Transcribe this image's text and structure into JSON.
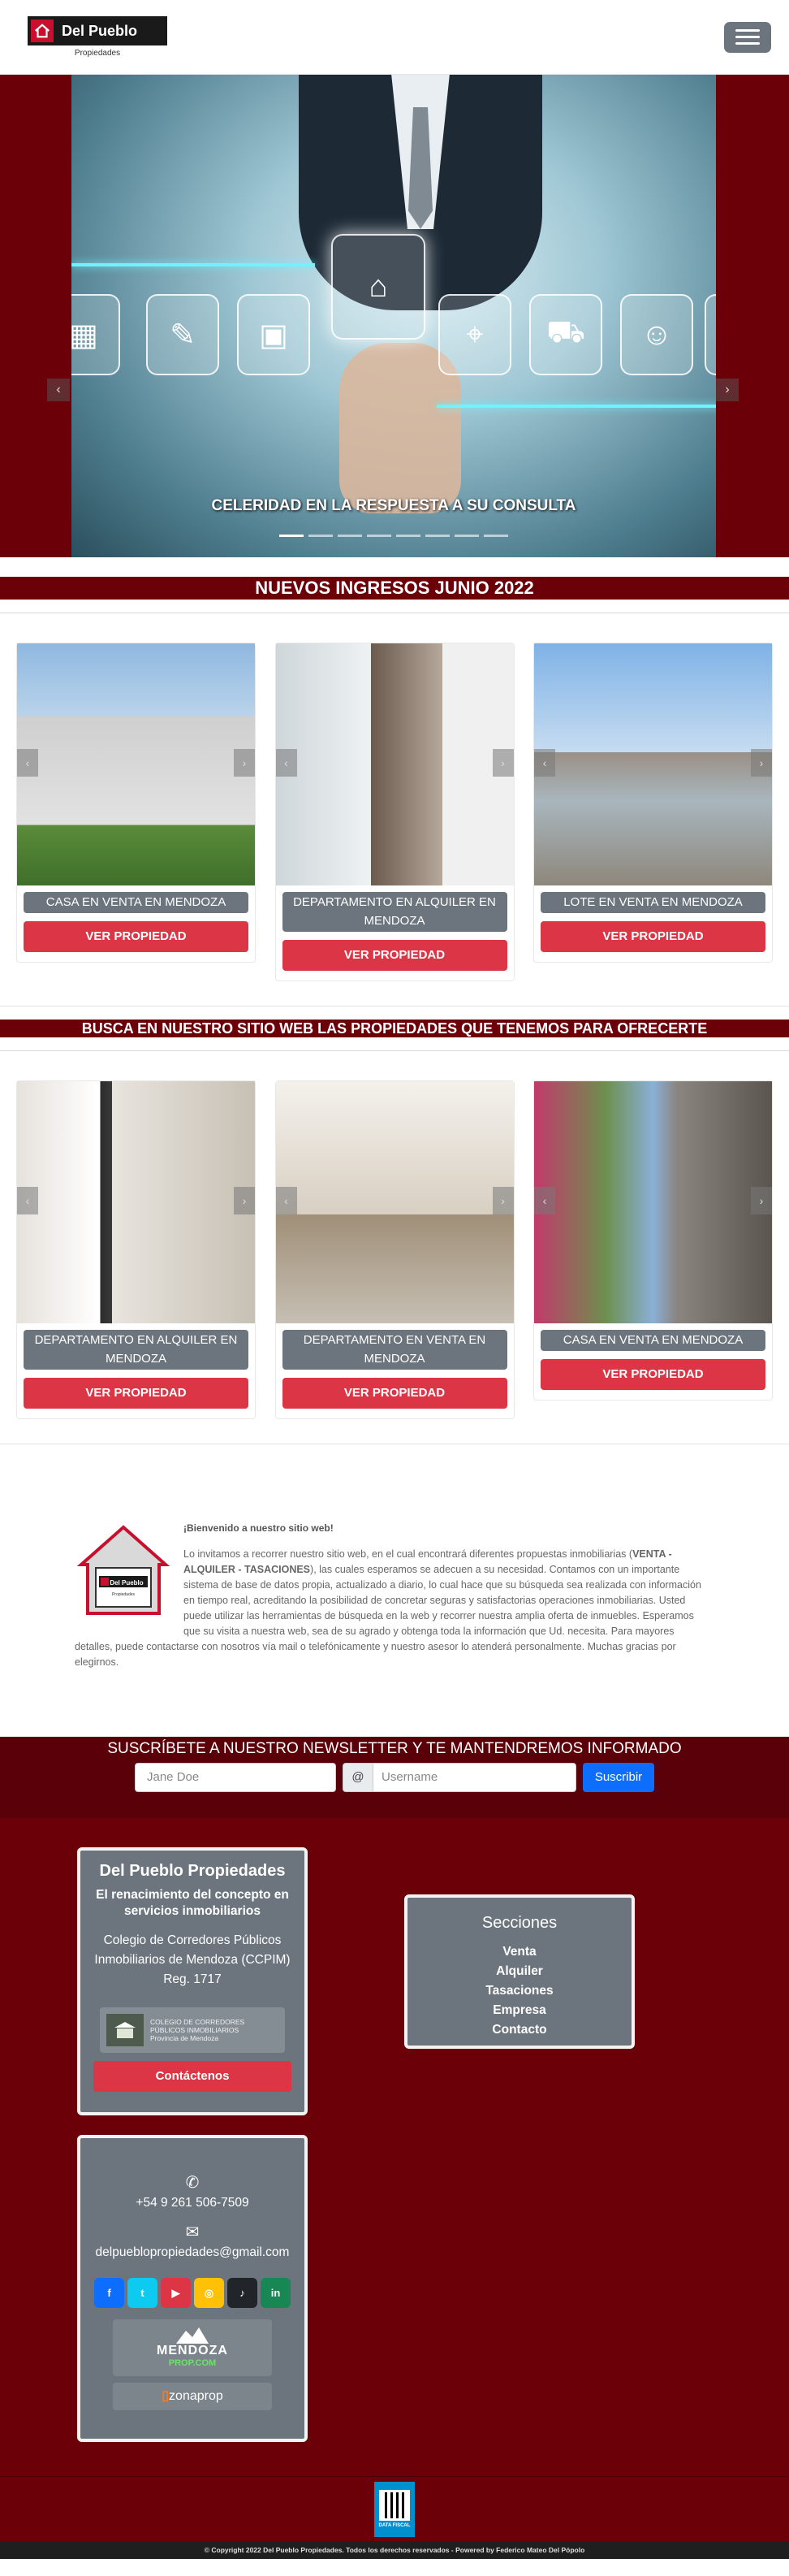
{
  "brand": {
    "name": "Del Pueblo",
    "tagline": "Propiedades"
  },
  "hero": {
    "caption": "CELERIDAD EN LA RESPUESTA A SU CONSULTA",
    "slide_count": 8,
    "active_slide": 1
  },
  "section1": {
    "title": "NUEVOS INGRESOS JUNIO 2022"
  },
  "cards_row1": [
    {
      "title": "CASA EN VENTA EN MENDOZA",
      "button": "VER PROPIEDAD"
    },
    {
      "title": "DEPARTAMENTO EN ALQUILER EN MENDOZA",
      "button": "VER PROPIEDAD"
    },
    {
      "title": "LOTE EN VENTA EN MENDOZA",
      "button": "VER PROPIEDAD"
    }
  ],
  "section2": {
    "title": "BUSCA EN NUESTRO SITIO WEB LAS PROPIEDADES QUE TENEMOS PARA OFRECERTE"
  },
  "cards_row2": [
    {
      "title": "DEPARTAMENTO EN ALQUILER EN MENDOZA",
      "button": "VER PROPIEDAD"
    },
    {
      "title": "DEPARTAMENTO EN VENTA EN MENDOZA",
      "button": "VER PROPIEDAD"
    },
    {
      "title": "CASA EN VENTA EN MENDOZA",
      "button": "VER PROPIEDAD"
    }
  ],
  "welcome": {
    "title": "¡Bienvenido a nuestro sitio web!",
    "text_before": "Lo invitamos a recorrer nuestro sitio web, en el cual encontrará diferentes propuestas inmobiliarias (",
    "text_bold": "VENTA - ALQUILER - TASACIONES",
    "text_after": "), las cuales esperamos se adecuen a su necesidad. Contamos con un importante sistema de base de datos propia, actualizado a diario, lo cual hace que su búsqueda sea realizada con información en tiempo real, acreditando la posibilidad de concretar seguras y satisfactorias operaciones inmobiliarias. Usted puede utilizar las herramientas de búsqueda en la web y recorrer nuestra amplia oferta de inmuebles. Esperamos que su visita a nuestra web, sea de su agrado y obtenga toda la información que Ud. necesita. Para mayores detalles, puede contactarse con nosotros vía mail o telefónicamente y nuestro asesor lo atenderá personalmente. Muchas gracias por elegirnos."
  },
  "newsletter": {
    "title": "SUSCRÍBETE A NUESTRO NEWSLETTER Y TE MANTENDREMOS INFORMADO",
    "name_placeholder": "Jane Doe",
    "at": "@",
    "user_placeholder": "Username",
    "button": "Suscribir"
  },
  "footer": {
    "company": {
      "title": "Del Pueblo Propiedades",
      "subtitle": "El renacimiento del concepto en servicios inmobiliarios",
      "registry": "Colegio de Corredores Públicos Inmobiliarios de Mendoza (CCPIM) Reg. 1717",
      "colegio_line1": "COLEGIO DE CORREDORES",
      "colegio_line2": "PÚBLICOS INMOBILIARIOS",
      "colegio_line3": "Provincia de Mendoza",
      "contact_button": "Contáctenos"
    },
    "sections": {
      "title": "Secciones",
      "links": [
        "Venta",
        "Alquiler",
        "Tasaciones",
        "Empresa",
        "Contacto"
      ]
    },
    "contact": {
      "phone": "+54 9 261 506-7509",
      "email": "delpueblopropiedades@gmail.com",
      "socials": [
        {
          "name": "facebook",
          "glyph": "f",
          "color": "#0d6efd"
        },
        {
          "name": "twitter",
          "glyph": "t",
          "color": "#0dcaf0"
        },
        {
          "name": "youtube",
          "glyph": "▶",
          "color": "#dc3545"
        },
        {
          "name": "instagram",
          "glyph": "◎",
          "color": "#ffc107"
        },
        {
          "name": "tiktok",
          "glyph": "♪",
          "color": "#212529"
        },
        {
          "name": "linkedin",
          "glyph": "in",
          "color": "#198754"
        }
      ],
      "mendoza_line1": "MENDOZA",
      "mendoza_line2": "PROP.COM",
      "zonaprop": "zonaprop"
    },
    "qr_label": "DATA FISCAL"
  },
  "copyright": "© Copyright 2022 Del Pueblo Propiedades. Todos los derechos reservados - Powered by Federico Mateo Del Pópolo",
  "colors": {
    "brand_red": "#6b0008",
    "button_red": "#dc3545",
    "gray": "#6c757d",
    "blue": "#0d6efd"
  }
}
